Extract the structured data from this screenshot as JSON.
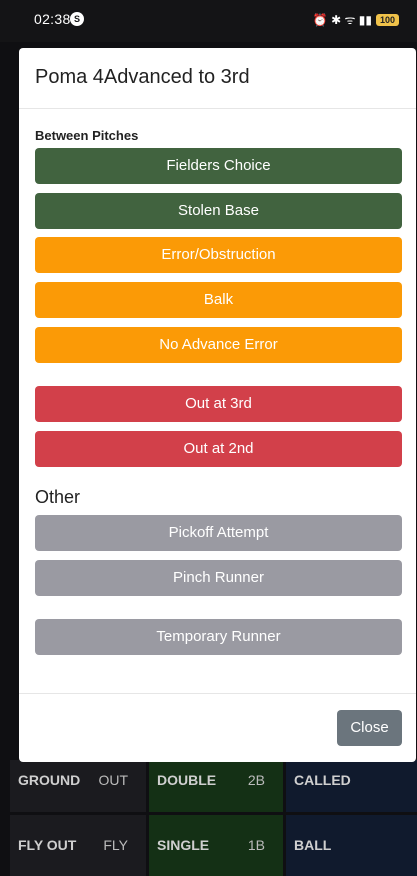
{
  "status_bar": {
    "time": "02:38",
    "notification_badge": "S",
    "right_icons": "⏰ ✱ ᯤ ▮▮",
    "battery": "100"
  },
  "modal": {
    "title": "Poma 4Advanced to 3rd",
    "between_pitches_label": "Between Pitches",
    "between_pitches": [
      "Fielders Choice",
      "Stolen Base",
      "Error/Obstruction",
      "Balk",
      "No Advance Error"
    ],
    "outs": [
      "Out at 3rd",
      "Out at 2nd"
    ],
    "other_label": "Other",
    "other": [
      "Pickoff Attempt",
      "Pinch Runner",
      "Temporary Runner"
    ],
    "close_label": "Close"
  },
  "background_grid": {
    "row1": [
      "GROUND",
      "OUT",
      "DOUBLE",
      "2B",
      "CALLED"
    ],
    "row2": [
      "FLY OUT",
      "FLY",
      "SINGLE",
      "1B",
      "BALL"
    ]
  },
  "colors": {
    "green": "#41633f",
    "orange": "#fb9a06",
    "red": "#d2404a",
    "grey": "#9a9aa2",
    "close": "#6b757d"
  }
}
